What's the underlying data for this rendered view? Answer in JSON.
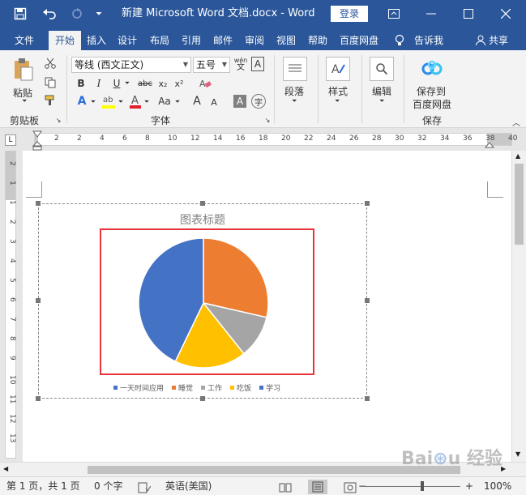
{
  "title_bar": {
    "title": "新建 Microsoft Word 文档.docx  -  Word",
    "login_label": "登录",
    "window_buttons": [
      "ribbon-display-icon",
      "minimize-icon",
      "maximize-icon",
      "close-icon"
    ]
  },
  "ribbon_tabs": [
    {
      "label": "文件"
    },
    {
      "label": "开始"
    },
    {
      "label": "插入"
    },
    {
      "label": "设计"
    },
    {
      "label": "布局"
    },
    {
      "label": "引用"
    },
    {
      "label": "邮件"
    },
    {
      "label": "审阅"
    },
    {
      "label": "视图"
    },
    {
      "label": "帮助"
    },
    {
      "label": "百度网盘"
    },
    {
      "label": "告诉我"
    }
  ],
  "share_label": "共享",
  "ribbon": {
    "clipboard": {
      "paste_label": "粘贴",
      "group_label": "剪贴板"
    },
    "font": {
      "font_name": "等线 (西文正文)",
      "font_size": "五号",
      "group_label": "字体",
      "bold": "B",
      "italic": "I",
      "underline": "U",
      "strike": "abc",
      "subscript": "x₂",
      "superscript": "x²",
      "clear_format": "A",
      "font_color": "A",
      "change_case": "Aa",
      "grow": "A",
      "shrink": "A",
      "char_border": "A",
      "wen": "wén"
    },
    "paragraph": {
      "label": "段落"
    },
    "styles": {
      "label": "样式"
    },
    "editing": {
      "label": "编辑"
    },
    "save": {
      "label_line1": "保存到",
      "label_line2": "百度网盘",
      "group_label": "保存"
    }
  },
  "ruler": {
    "ticks": [
      "2",
      "2",
      "4",
      "6",
      "8",
      "10",
      "12",
      "14",
      "16",
      "18",
      "20",
      "22",
      "24",
      "26",
      "28",
      "30",
      "32",
      "34",
      "36",
      "38",
      "40"
    ],
    "vticks": [
      "2",
      "1",
      "1",
      "2",
      "3",
      "4",
      "5",
      "6",
      "7",
      "8",
      "9",
      "10",
      "11",
      "12",
      "13"
    ]
  },
  "chart": {
    "title": "图表标题",
    "legend": [
      {
        "name": "一天时间应用",
        "color": "#4472c4"
      },
      {
        "name": "睡觉",
        "color": "#ed7d31"
      },
      {
        "name": "工作",
        "color": "#a5a5a5"
      },
      {
        "name": "吃饭",
        "color": "#ffc000"
      },
      {
        "name": "学习",
        "color": "#4472c4"
      }
    ]
  },
  "chart_data": {
    "type": "pie",
    "title": "图表标题",
    "categories": [
      "睡觉",
      "工作",
      "吃饭",
      "学习"
    ],
    "values": [
      8,
      3,
      5,
      12
    ],
    "colors": [
      "#ed7d31",
      "#a5a5a5",
      "#ffc000",
      "#4472c4"
    ]
  },
  "status_bar": {
    "page": "第 1 页，共 1 页",
    "words": "0 个字",
    "language": "英语(美国)",
    "zoom": "100%",
    "zoom_minus": "−",
    "zoom_plus": "+"
  },
  "watermark": "Baidu 经验"
}
